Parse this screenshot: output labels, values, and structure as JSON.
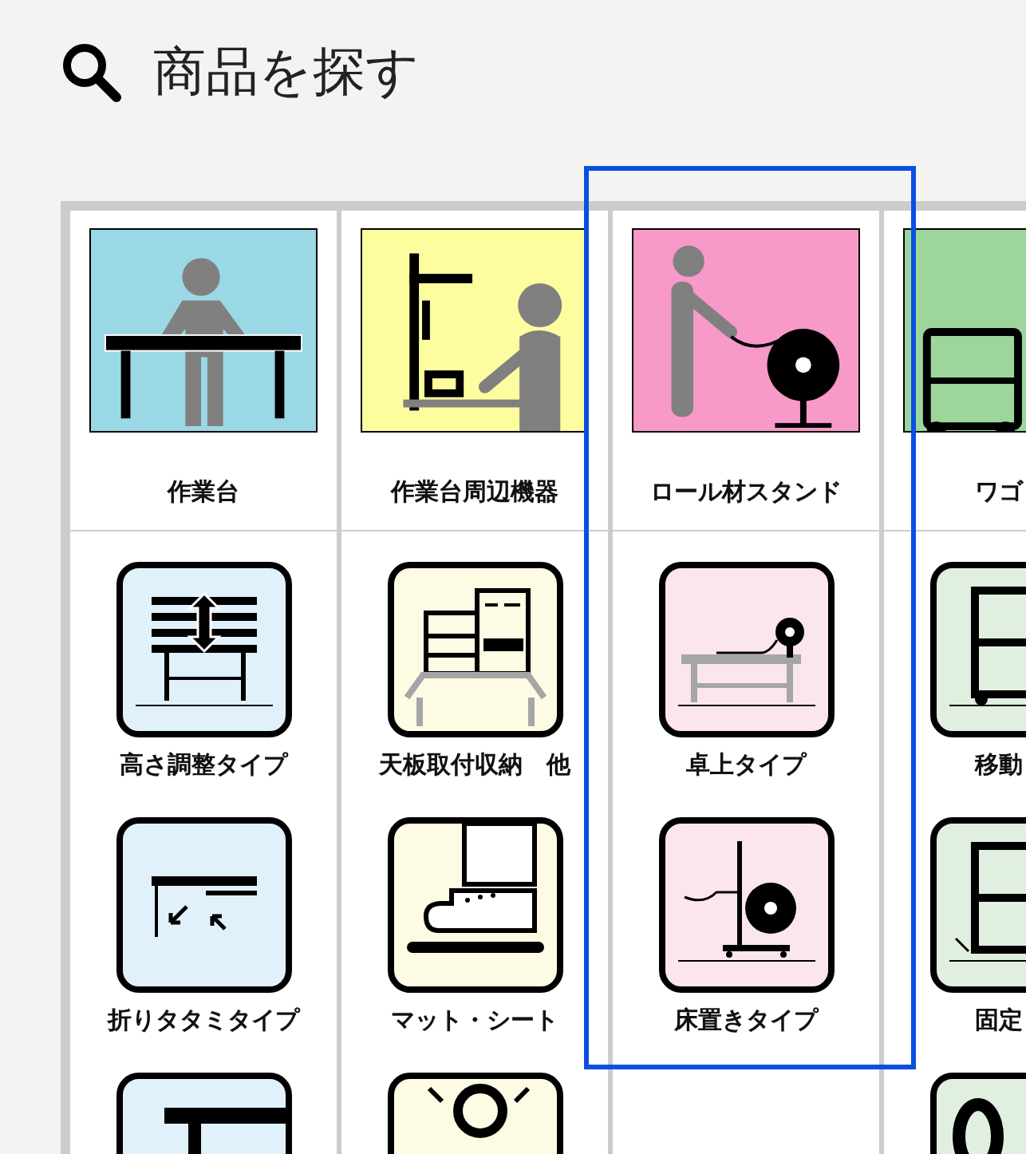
{
  "search": {
    "title": "商品を探す"
  },
  "categories": [
    {
      "label": "作業台",
      "selected": false,
      "items": [
        {
          "kind": "full",
          "label": "高さ調整タイプ"
        },
        {
          "kind": "full",
          "label": "折りタタミタイプ"
        },
        {
          "kind": "cut"
        }
      ]
    },
    {
      "label": "作業台周辺機器",
      "selected": false,
      "items": [
        {
          "kind": "full",
          "label": "天板取付収納　他"
        },
        {
          "kind": "full",
          "label": "マット・シート"
        },
        {
          "kind": "cut"
        }
      ]
    },
    {
      "label": "ロール材スタンド",
      "selected": true,
      "items": [
        {
          "kind": "full",
          "label": "卓上タイプ"
        },
        {
          "kind": "full",
          "label": "床置きタイプ"
        }
      ]
    },
    {
      "label": "ワゴ",
      "selected": false,
      "items": [
        {
          "kind": "full",
          "label": "移動"
        },
        {
          "kind": "full",
          "label": "固定"
        },
        {
          "kind": "cut"
        }
      ]
    }
  ]
}
